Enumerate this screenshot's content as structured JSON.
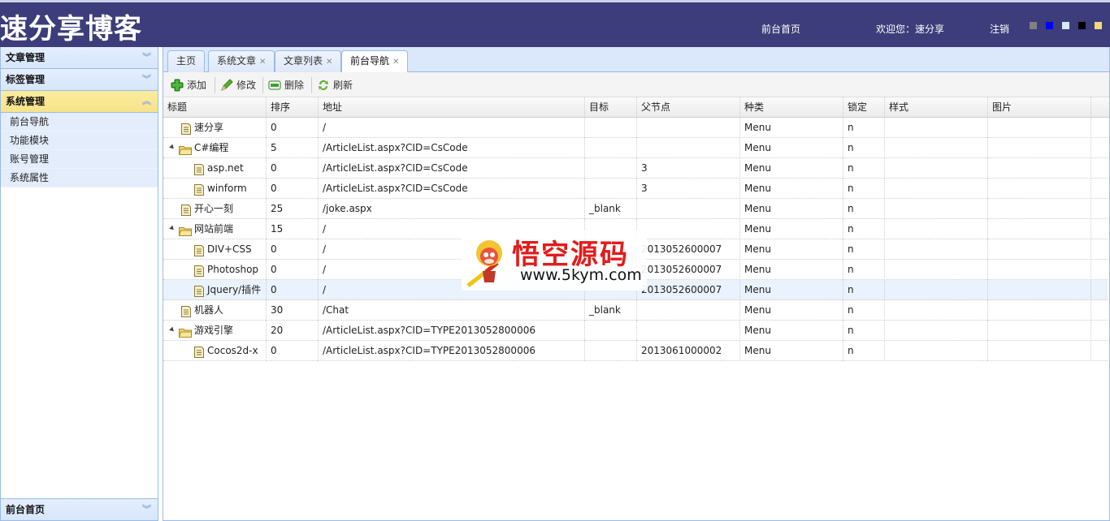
{
  "header": {
    "logo": "速分享博客",
    "front_home": "前台首页",
    "welcome": "欢迎您：速分享",
    "logout": "注销",
    "themes": [
      {
        "name": "gray",
        "color": "#808080"
      },
      {
        "name": "blue",
        "color": "#0000ff"
      },
      {
        "name": "light-blue",
        "color": "#d7e6fb"
      },
      {
        "name": "black",
        "color": "#000000"
      },
      {
        "name": "yellow",
        "color": "#f5d97a"
      }
    ]
  },
  "sidebar": {
    "sections": [
      {
        "label": "文章管理",
        "expanded": false
      },
      {
        "label": "标签管理",
        "expanded": false
      },
      {
        "label": "系统管理",
        "expanded": true,
        "items": [
          "前台导航",
          "功能模块",
          "账号管理",
          "系统属性"
        ]
      }
    ],
    "bottom": {
      "label": "前台首页"
    }
  },
  "tabs": [
    {
      "label": "主页",
      "closable": false
    },
    {
      "label": "系统文章",
      "closable": true
    },
    {
      "label": "文章列表",
      "closable": true
    },
    {
      "label": "前台导航",
      "closable": true,
      "active": true
    }
  ],
  "toolbar": {
    "add": "添加",
    "edit": "修改",
    "delete": "删除",
    "refresh": "刷新"
  },
  "grid": {
    "columns": [
      "标题",
      "排序",
      "地址",
      "目标",
      "父节点",
      "种类",
      "锁定",
      "样式",
      "图片"
    ],
    "rows": [
      {
        "title": "速分享",
        "type": "file",
        "level": 0,
        "order": "0",
        "url": "/",
        "target": "",
        "parent": "",
        "kind": "Menu",
        "locked": "n",
        "style": "",
        "image": ""
      },
      {
        "title": "C#编程",
        "type": "folder",
        "level": 0,
        "order": "5",
        "url": "/ArticleList.aspx?CID=CsCode",
        "target": "",
        "parent": "",
        "kind": "Menu",
        "locked": "n",
        "style": "",
        "image": ""
      },
      {
        "title": "asp.net",
        "type": "file",
        "level": 1,
        "order": "0",
        "url": "/ArticleList.aspx?CID=CsCode",
        "target": "",
        "parent": "3",
        "kind": "Menu",
        "locked": "n",
        "style": "",
        "image": ""
      },
      {
        "title": "winform",
        "type": "file",
        "level": 1,
        "order": "0",
        "url": "/ArticleList.aspx?CID=CsCode",
        "target": "",
        "parent": "3",
        "kind": "Menu",
        "locked": "n",
        "style": "",
        "image": ""
      },
      {
        "title": "开心一刻",
        "type": "file",
        "level": 0,
        "order": "25",
        "url": "/joke.aspx",
        "target": "_blank",
        "parent": "",
        "kind": "Menu",
        "locked": "n",
        "style": "",
        "image": ""
      },
      {
        "title": "网站前端",
        "type": "folder",
        "level": 0,
        "order": "15",
        "url": "/",
        "target": "",
        "parent": "",
        "kind": "Menu",
        "locked": "n",
        "style": "",
        "image": ""
      },
      {
        "title": "DIV+CSS",
        "type": "file",
        "level": 1,
        "order": "0",
        "url": "/",
        "target": "",
        "parent": "2013052600007",
        "kind": "Menu",
        "locked": "n",
        "style": "",
        "image": ""
      },
      {
        "title": "Photoshop",
        "type": "file",
        "level": 1,
        "order": "0",
        "url": "/",
        "target": "",
        "parent": "2013052600007",
        "kind": "Menu",
        "locked": "n",
        "style": "",
        "image": ""
      },
      {
        "title": "Jquery/插件",
        "type": "file",
        "level": 1,
        "order": "0",
        "url": "/",
        "target": "",
        "parent": "2013052600007",
        "kind": "Menu",
        "locked": "n",
        "style": "",
        "image": "",
        "selected": true
      },
      {
        "title": "机器人",
        "type": "file",
        "level": 0,
        "order": "30",
        "url": "/Chat",
        "target": "_blank",
        "parent": "",
        "kind": "Menu",
        "locked": "n",
        "style": "",
        "image": ""
      },
      {
        "title": "游戏引擎",
        "type": "folder",
        "level": 0,
        "order": "20",
        "url": "/ArticleList.aspx?CID=TYPE2013052800006",
        "target": "",
        "parent": "",
        "kind": "Menu",
        "locked": "n",
        "style": "",
        "image": ""
      },
      {
        "title": "Cocos2d-x",
        "type": "file",
        "level": 1,
        "order": "0",
        "url": "/ArticleList.aspx?CID=TYPE2013052800006",
        "target": "",
        "parent": "2013061000002",
        "kind": "Menu",
        "locked": "n",
        "style": "",
        "image": ""
      }
    ]
  },
  "watermark": {
    "title": "悟空源码",
    "url": "www.5kym.com"
  }
}
